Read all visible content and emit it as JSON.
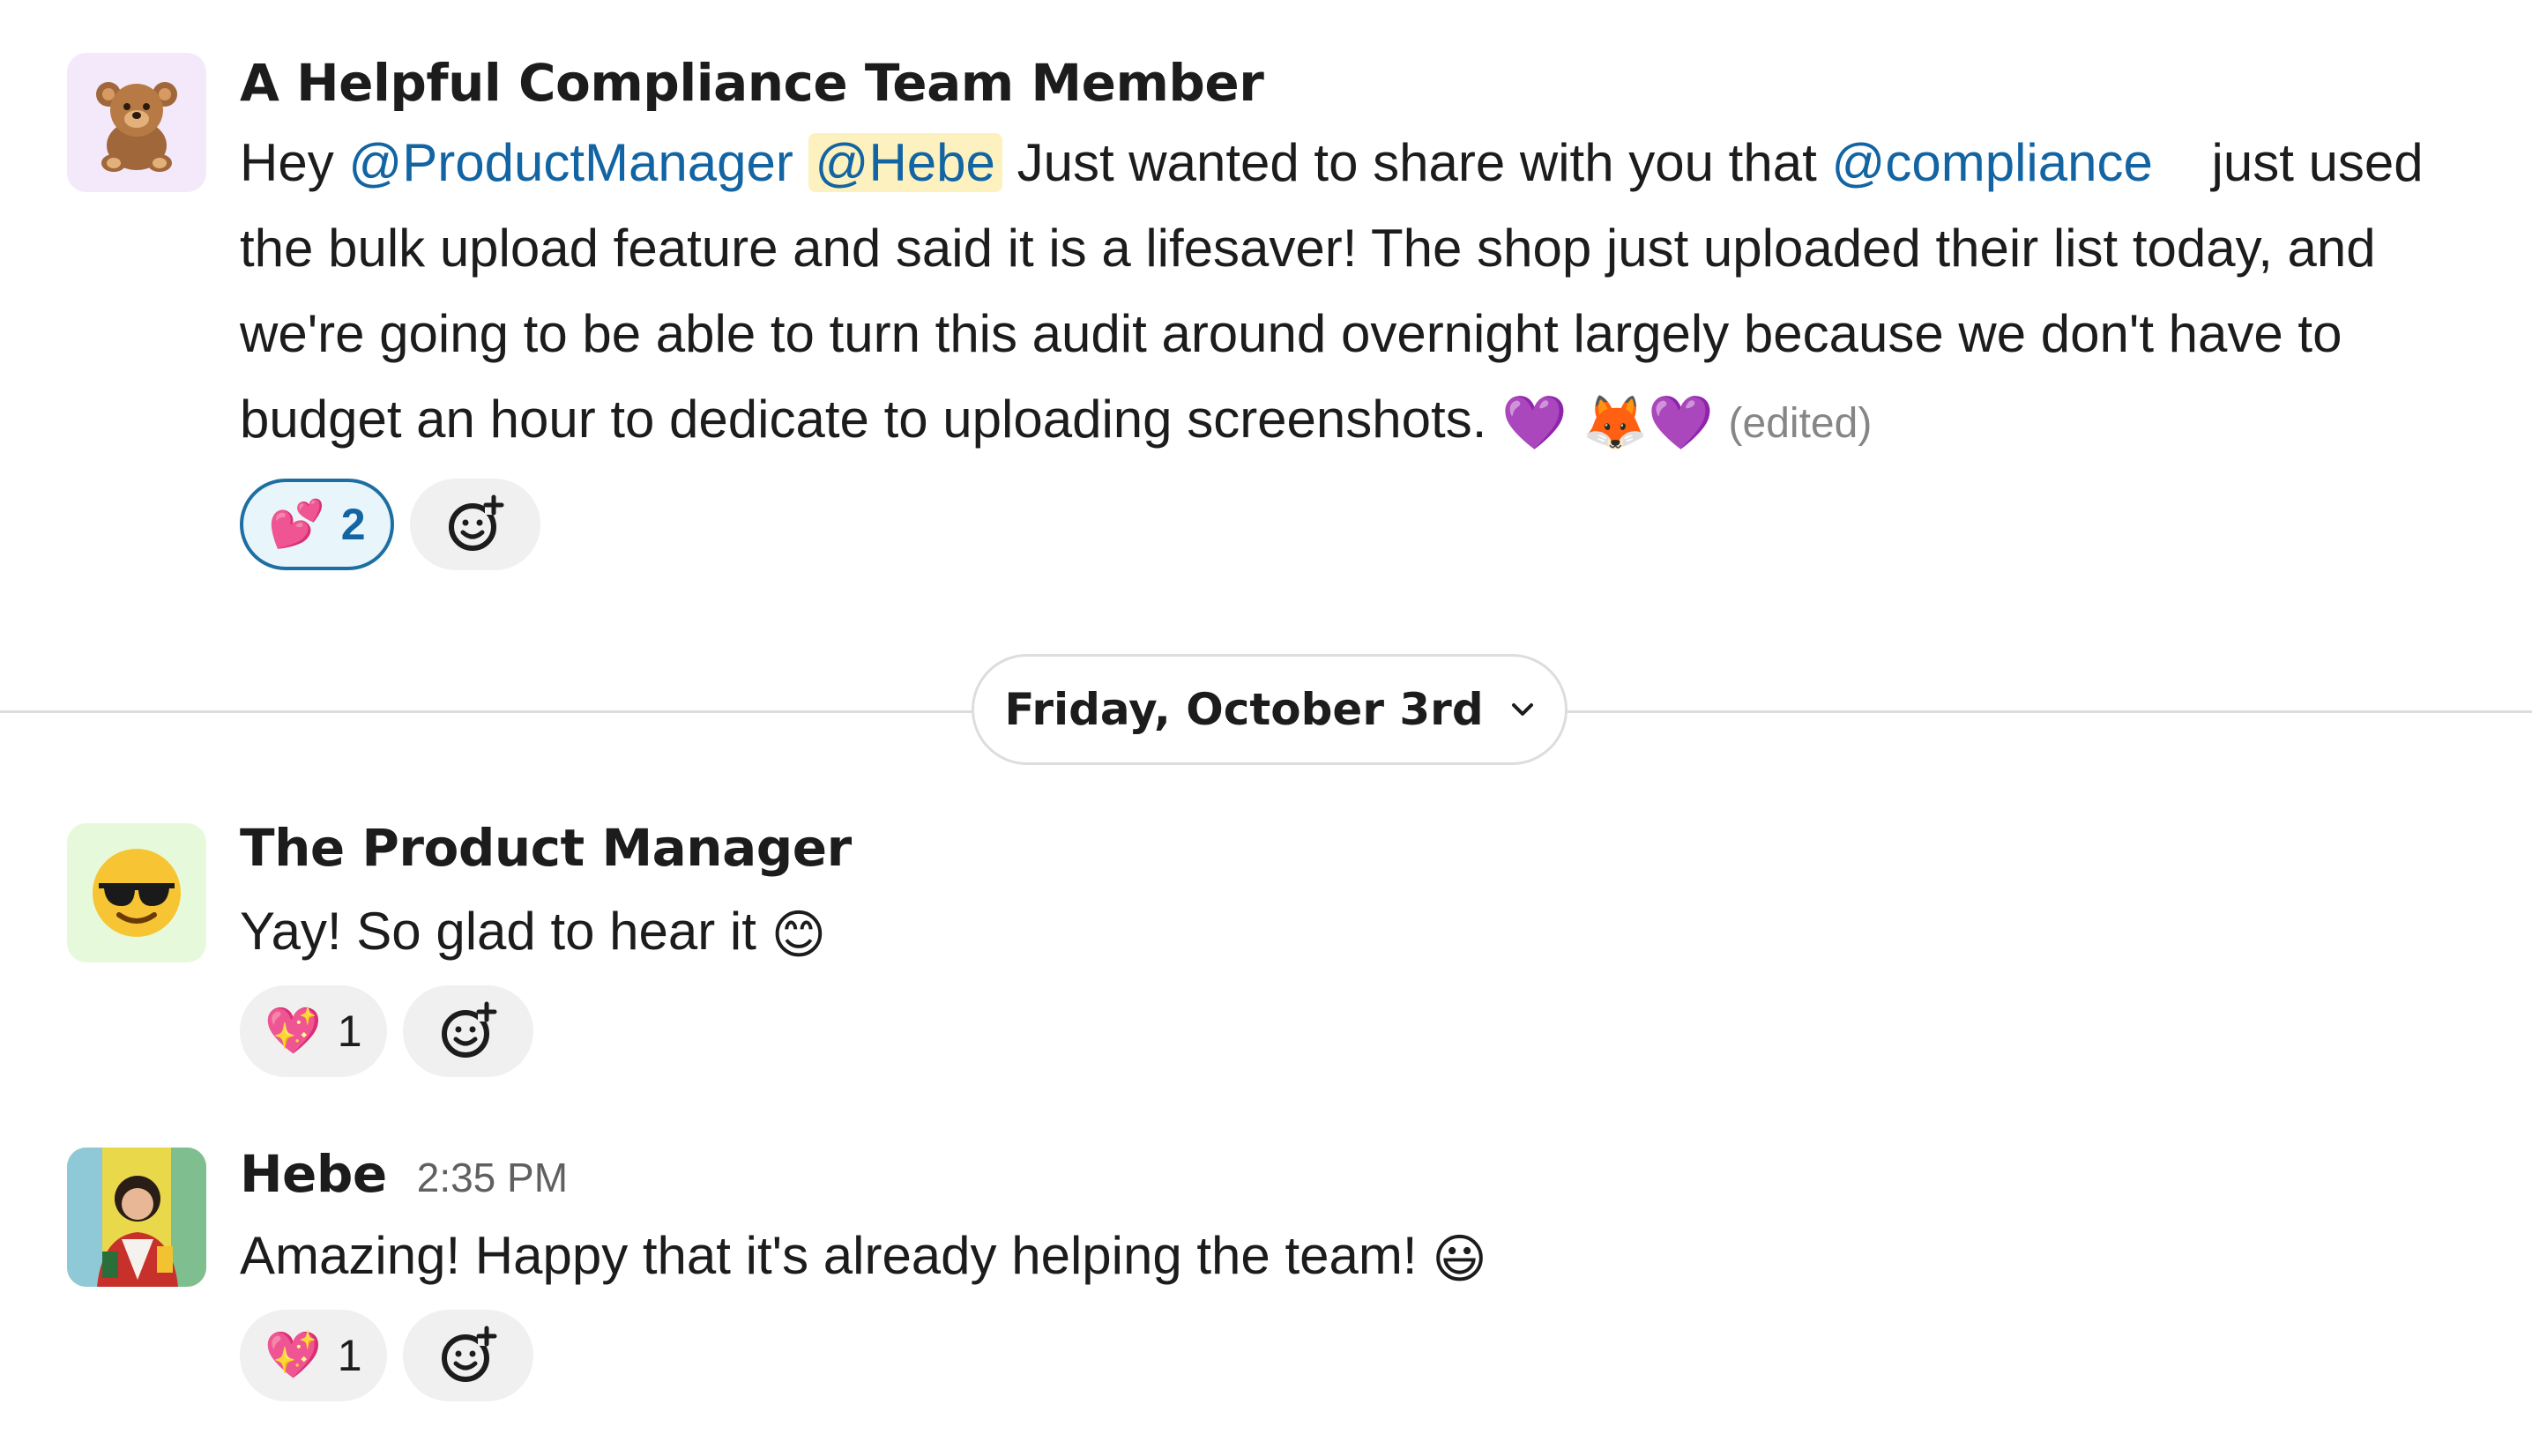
{
  "messages": [
    {
      "sender": "A Helpful Compliance Team Member",
      "avatar_icon": "teddy-bear-icon",
      "text_parts": {
        "greeting": "Hey ",
        "mention_pm": "@ProductManager",
        "mention_hebe": "@Hebe",
        "part1": " Just wanted to share with you that ",
        "mention_compliance": "@compliance",
        "part2": "    just used the bulk upload feature and said it is a lifesaver! The shop just uploaded their list today, and we're going to be able to turn this audit around overnight largely because we don't have to budget an hour to dedicate to uploading screenshots. ",
        "emoji_heart1": "💜",
        "emoji_fox": "🦊",
        "emoji_heart2": "💜",
        "edited": "(edited)"
      },
      "reactions": [
        {
          "emoji": "💕",
          "count": "2",
          "active": true
        }
      ]
    },
    {
      "sender": "The Product Manager",
      "avatar_icon": "sunglasses-face-icon",
      "text": "Yay! So glad to hear it",
      "text_emoji": "😊",
      "reactions": [
        {
          "emoji": "💖",
          "count": "1",
          "active": false
        }
      ]
    },
    {
      "sender": "Hebe",
      "time": "2:35 PM",
      "avatar_icon": "user-photo",
      "text": "Amazing! Happy that it's already helping the team!",
      "text_emoji": "😃",
      "reactions": [
        {
          "emoji": "💖",
          "count": "1",
          "active": false
        }
      ]
    }
  ],
  "date_divider": {
    "label": "Friday, October 3rd"
  },
  "colors": {
    "mention": "#1264a3",
    "self_mention_bg": "#fdf2bf",
    "active_reaction_border": "#1d6fa3",
    "active_reaction_bg": "#e8f5fa"
  }
}
